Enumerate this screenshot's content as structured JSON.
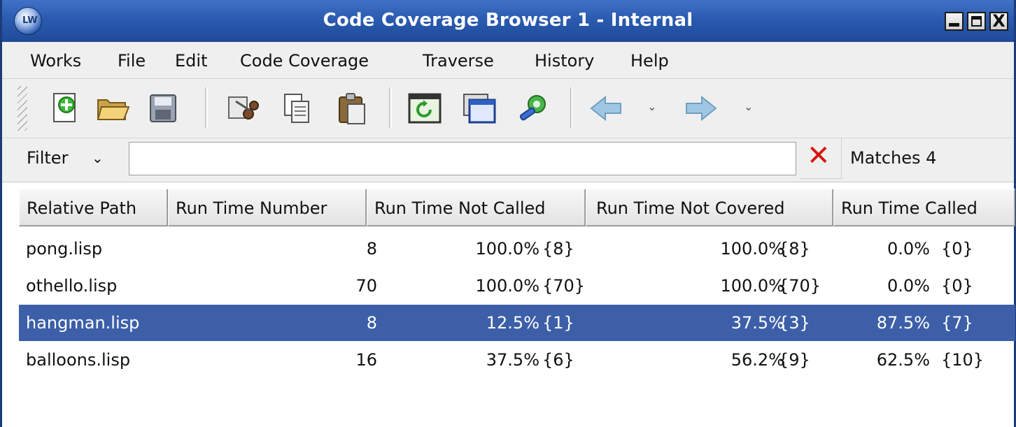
{
  "window": {
    "title": "Code Coverage Browser 1 - Internal",
    "app_icon_text": "LW",
    "controls": {
      "minimize_icon": "minimize-icon",
      "maximize_icon": "maximize-icon",
      "close_glyph": "X"
    }
  },
  "menu": [
    "Works",
    "File",
    "Edit",
    "Code Coverage",
    "Traverse",
    "History",
    "Help"
  ],
  "toolbar": {
    "icons": [
      "new-icon",
      "open-folder-icon",
      "save-icon",
      "cut-icon",
      "copy-icon",
      "paste-icon",
      "refresh-window-icon",
      "new-window-icon",
      "tools-gear-icon",
      "back-arrow-icon",
      "back-dropdown-icon",
      "forward-arrow-icon",
      "forward-dropdown-icon"
    ]
  },
  "filter": {
    "label": "Filter",
    "chevron": "⌄",
    "value": "",
    "placeholder": "",
    "clear_glyph": "✕",
    "matches_text": "Matches 4"
  },
  "table": {
    "columns": [
      "Relative Path",
      "Run Time Number",
      "Run Time Not Called",
      "Run Time Not Covered",
      "Run Time Called"
    ],
    "rows": [
      {
        "path": "pong.lisp",
        "number": "8",
        "not_called_pct": "100.0%",
        "not_called_count": "{8}",
        "not_covered_pct": "100.0%",
        "not_covered_count": "{8}",
        "called_pct": "0.0%",
        "called_count": "{0}",
        "selected": false
      },
      {
        "path": "othello.lisp",
        "number": "70",
        "not_called_pct": "100.0%",
        "not_called_count": "{70}",
        "not_covered_pct": "100.0%",
        "not_covered_count": "{70}",
        "called_pct": "0.0%",
        "called_count": "{0}",
        "selected": false
      },
      {
        "path": "hangman.lisp",
        "number": "8",
        "not_called_pct": "12.5%",
        "not_called_count": "{1}",
        "not_covered_pct": "37.5%",
        "not_covered_count": "{3}",
        "called_pct": "87.5%",
        "called_count": "{7}",
        "selected": true
      },
      {
        "path": "balloons.lisp",
        "number": "16",
        "not_called_pct": "37.5%",
        "not_called_count": "{6}",
        "not_covered_pct": "56.2%",
        "not_covered_count": "{9}",
        "called_pct": "62.5%",
        "called_count": "{10}",
        "selected": false
      }
    ]
  },
  "colors": {
    "titlebar": "#2b5bb0",
    "selection": "#3c5fa8",
    "clear_x": "#d4170f"
  }
}
